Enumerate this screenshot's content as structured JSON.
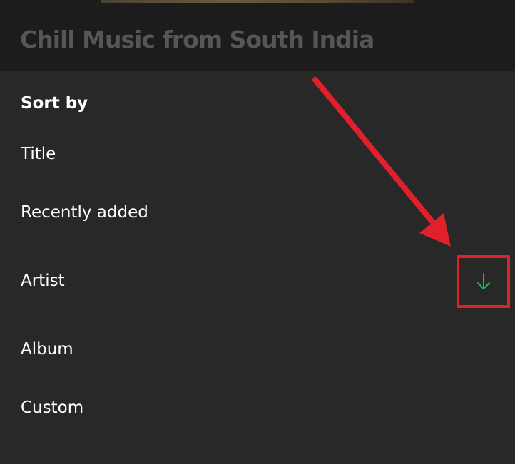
{
  "header": {
    "playlist_title": "Chill Music from South India"
  },
  "sort_sheet": {
    "heading": "Sort by",
    "options": [
      {
        "label": "Title"
      },
      {
        "label": "Recently added"
      },
      {
        "label": "Artist",
        "selected": true,
        "direction": "descending"
      },
      {
        "label": "Album"
      },
      {
        "label": "Custom"
      }
    ]
  },
  "icons": {
    "sort_direction": "arrow-down-icon",
    "annotation": "red-arrow-annotation"
  },
  "colors": {
    "background": "#282828",
    "header_background": "#1c1c1c",
    "title_text": "#565656",
    "option_text": "#ffffff",
    "accent_green": "#1db954",
    "annotation_red": "#e0202a"
  }
}
